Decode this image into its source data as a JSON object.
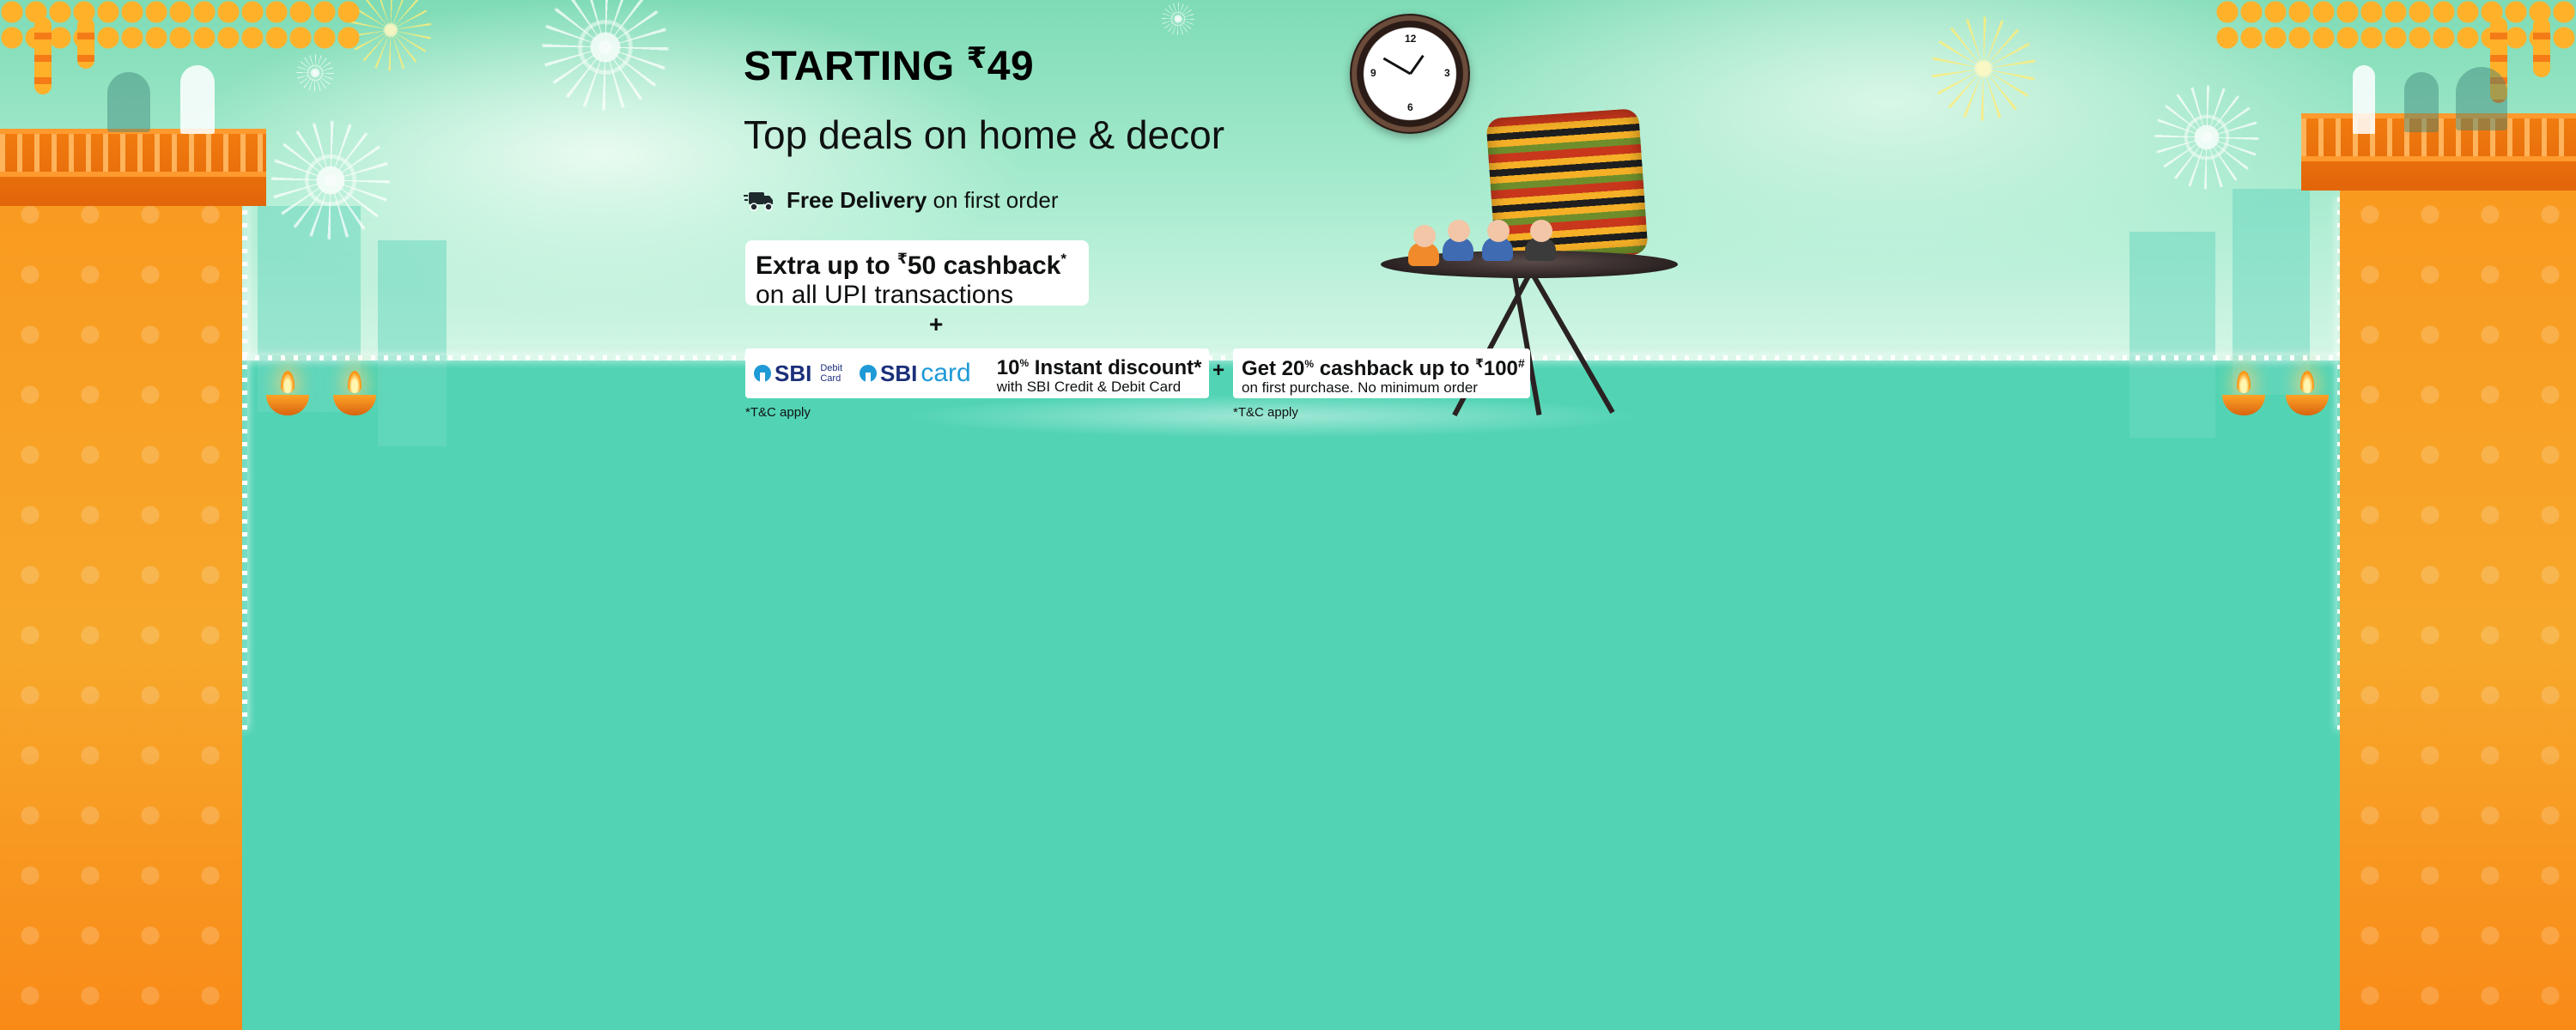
{
  "banner": {
    "headline_prefix": "STARTING",
    "headline_currency": "₹",
    "headline_price": "49",
    "subheadline": "Top deals on home & decor",
    "delivery_bold": "Free Delivery",
    "delivery_rest": "on first order"
  },
  "upi_offer": {
    "title_prefix": "Extra up to",
    "currency": "₹",
    "title_rest": "50 cashback",
    "asterisk": "*",
    "subtitle": "on all UPI transactions"
  },
  "sbi_offer": {
    "logo_text": "SBI",
    "debit_line1": "Debit",
    "debit_line2": "Card",
    "card_logo_text": "SBI",
    "card_word": "card",
    "percent": "10",
    "percent_sign": "%",
    "title_rest": "Instant discount*",
    "subtitle": "with SBI Credit & Debit Card",
    "tc": "*T&C apply"
  },
  "cashback_offer": {
    "title_prefix": "Get 20",
    "percent_sign": "%",
    "title_mid": "cashback up to",
    "currency": "₹",
    "amount": "100",
    "hash": "#",
    "subtitle": "on first purchase. No minimum order",
    "tc": "*T&C apply"
  },
  "connectors": {
    "plus_1": "+",
    "plus_2": "+"
  },
  "colors": {
    "page_bg": "#52d4b4",
    "pillar_orange": "#f99a1f",
    "text_dark": "#0f1111",
    "sbi_navy": "#1b2f7a",
    "sbi_blue": "#1e9ad6"
  },
  "icons": [
    "delivery-truck-icon",
    "sbi-logo-icon",
    "wall-clock-image",
    "cushion-image",
    "side-table-image",
    "monk-figurines-image",
    "diya-lamp-icon",
    "firework-decoration"
  ]
}
